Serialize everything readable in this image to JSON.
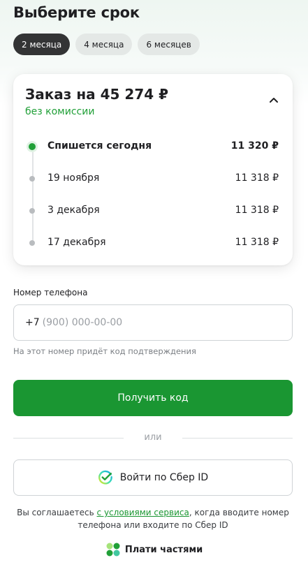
{
  "title": "Выберите срок",
  "tabs": [
    {
      "label": "2 месяца",
      "active": true
    },
    {
      "label": "4 месяца",
      "active": false
    },
    {
      "label": "6 месяцев",
      "active": false
    }
  ],
  "order": {
    "title": "Заказ на 45 274 ₽",
    "subtitle": "без комиссии",
    "schedule": [
      {
        "label": "Спишется сегодня",
        "amount": "11 320 ₽"
      },
      {
        "label": "19 ноября",
        "amount": "11 318 ₽"
      },
      {
        "label": "3 декабря",
        "amount": "11 318 ₽"
      },
      {
        "label": "17 декабря",
        "amount": "11 318 ₽"
      }
    ]
  },
  "phone": {
    "label": "Номер телефона",
    "prefix": "+7",
    "placeholder": "(900) 000-00-00",
    "hint": "На этот номер придёт код подтверждения"
  },
  "actions": {
    "get_code": "Получить код",
    "or": "или",
    "sber_id": "Войти по Сбер ID"
  },
  "legal": {
    "before": "Вы соглашаетесь ",
    "link": "с условиями сервиса",
    "after": ", когда вводите номер телефона или входите по Сбер ID"
  },
  "brand": {
    "name": "Плати частями"
  },
  "colors": {
    "accent": "#21a038",
    "button": "#1a9632",
    "dark_tab": "#333435"
  },
  "icons": {
    "collapse": "chevron-up-icon",
    "sber": "sber-id-icon",
    "brand": "plati-chastyami-logo"
  }
}
